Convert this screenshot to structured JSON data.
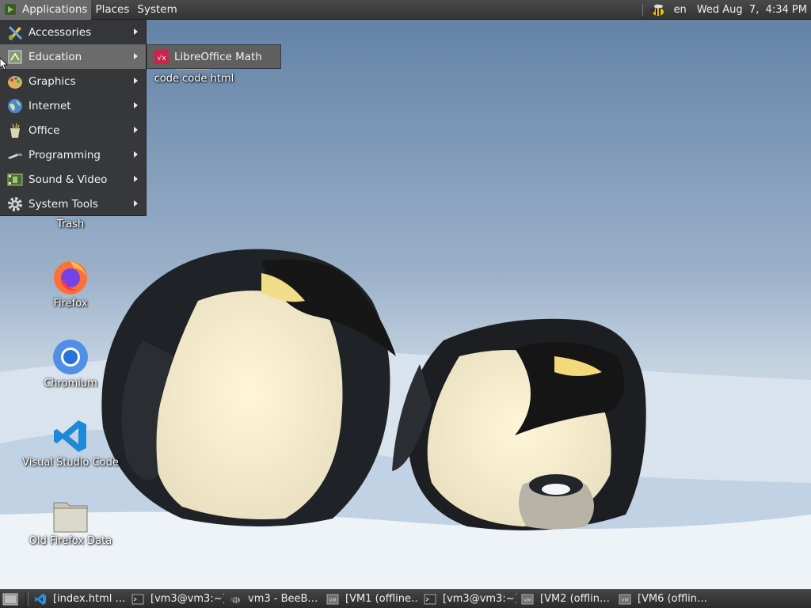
{
  "top_panel": {
    "menus": [
      {
        "label": "Applications",
        "active": true
      },
      {
        "label": "Places",
        "active": false
      },
      {
        "label": "System",
        "active": false
      }
    ],
    "tray": {
      "language": "en",
      "clock": "Wed Aug  7,  4:34 PM",
      "notification_icon": "bee-icon"
    }
  },
  "app_menu": {
    "items": [
      {
        "label": "Accessories",
        "icon": "accessories-icon",
        "active": false
      },
      {
        "label": "Education",
        "icon": "education-icon",
        "active": true
      },
      {
        "label": "Graphics",
        "icon": "graphics-icon",
        "active": false
      },
      {
        "label": "Internet",
        "icon": "internet-icon",
        "active": false
      },
      {
        "label": "Office",
        "icon": "office-icon",
        "active": false
      },
      {
        "label": "Programming",
        "icon": "programming-icon",
        "active": false
      },
      {
        "label": "Sound & Video",
        "icon": "sound-video-icon",
        "active": false
      },
      {
        "label": "System Tools",
        "icon": "system-tools-icon",
        "active": false
      }
    ],
    "education_submenu": [
      {
        "label": "LibreOffice Math",
        "icon": "libreoffice-math-icon"
      }
    ]
  },
  "desktop_icons": [
    {
      "label": "code code html",
      "icon": "folder-icon"
    },
    {
      "label": "Trash",
      "icon": "trash-icon"
    },
    {
      "label": "Firefox",
      "icon": "firefox-icon"
    },
    {
      "label": "Chromium",
      "icon": "chromium-icon"
    },
    {
      "label": "Visual Studio Code",
      "icon": "vscode-icon"
    },
    {
      "label": "Old Firefox Data",
      "icon": "folder-icon"
    }
  ],
  "taskbar": {
    "tasks": [
      {
        "label": "[index.html …",
        "icon": "vscode-icon"
      },
      {
        "label": "[vm3@vm3:~]",
        "icon": "terminal-icon"
      },
      {
        "label": "vm3 - BeeB…",
        "icon": "bee-icon"
      },
      {
        "label": "[VM1 (offline…",
        "icon": "vm-icon"
      },
      {
        "label": "[vm3@vm3:~]",
        "icon": "terminal-icon"
      },
      {
        "label": "[VM2 (offlin…",
        "icon": "vm-icon"
      },
      {
        "label": "[VM6 (offlin…",
        "icon": "vm-icon"
      }
    ]
  },
  "colors": {
    "panel": "#3a3a3a",
    "menu_background": "#303030",
    "menu_highlight": "#6b6b6b",
    "sky": "#8aa3bf",
    "snow": "#e8eef5"
  }
}
